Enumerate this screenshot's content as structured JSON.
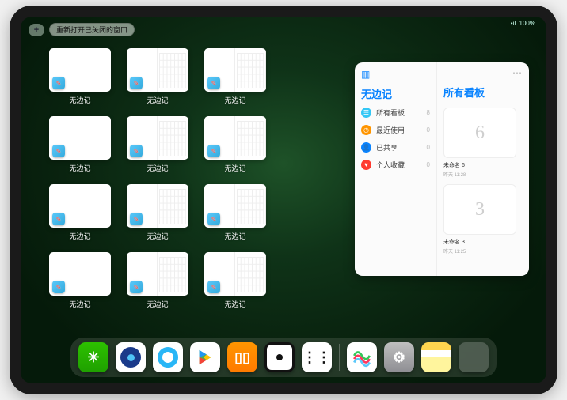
{
  "status": {
    "battery": "100%",
    "signal": "•ıl"
  },
  "topbar": {
    "plus": "+",
    "reopen_label": "重新打开已关闭的窗口"
  },
  "app_name": "无边记",
  "thumbs": [
    {
      "label": "无边记",
      "split": false
    },
    {
      "label": "无边记",
      "split": true
    },
    {
      "label": "无边记",
      "split": true
    },
    {
      "label": "无边记",
      "split": false
    },
    {
      "label": "无边记",
      "split": true
    },
    {
      "label": "无边记",
      "split": true
    },
    {
      "label": "无边记",
      "split": false
    },
    {
      "label": "无边记",
      "split": true
    },
    {
      "label": "无边记",
      "split": true
    },
    {
      "label": "无边记",
      "split": false
    },
    {
      "label": "无边记",
      "split": true
    },
    {
      "label": "无边记",
      "split": true
    }
  ],
  "sidepanel": {
    "left_title": "无边记",
    "items": [
      {
        "color": "#34c7f5",
        "glyph": "☰",
        "label": "所有看板",
        "count": "8"
      },
      {
        "color": "#ff9500",
        "glyph": "◷",
        "label": "最近使用",
        "count": "0"
      },
      {
        "color": "#0a84ff",
        "glyph": "👤",
        "label": "已共享",
        "count": "0"
      },
      {
        "color": "#ff3b30",
        "glyph": "♥",
        "label": "个人收藏",
        "count": "0"
      }
    ],
    "right_title": "所有看板",
    "boards": [
      {
        "sketch": "6",
        "name": "未命名 6",
        "time": "昨天 11:28"
      },
      {
        "sketch": "3",
        "name": "未命名 3",
        "time": "昨天 11:25"
      }
    ]
  },
  "dock": [
    {
      "name": "wechat",
      "glyph": "✳"
    },
    {
      "name": "quark-navy"
    },
    {
      "name": "quark-blue"
    },
    {
      "name": "play"
    },
    {
      "name": "books",
      "glyph": "▯▯"
    },
    {
      "name": "dot"
    },
    {
      "name": "graph",
      "glyph": "⋮⋮"
    },
    {
      "name": "freeform",
      "glyph": "〰"
    },
    {
      "name": "settings",
      "glyph": "⚙"
    },
    {
      "name": "notes"
    },
    {
      "name": "app-library"
    }
  ]
}
